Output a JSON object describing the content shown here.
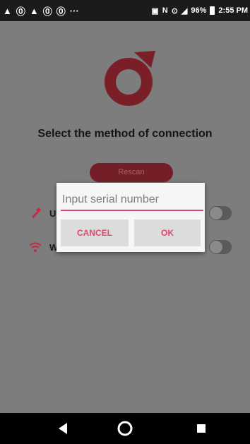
{
  "status_bar": {
    "notification_icons": [
      "warning-icon",
      "app-icon",
      "warning-icon",
      "app-icon",
      "app-icon"
    ],
    "overflow": "···",
    "battery": "96%",
    "time": "2:55 PM"
  },
  "main": {
    "title": "Select the method of connection",
    "rescan_label": "Rescan",
    "connections": [
      {
        "label": "US",
        "icon": "usb-icon",
        "color": "#c42a43"
      },
      {
        "label": "Wi",
        "icon": "wifi-icon",
        "color": "#c42a43"
      }
    ]
  },
  "dialog": {
    "placeholder": "Input serial number",
    "value": "",
    "cancel_label": "CANCEL",
    "ok_label": "OK"
  },
  "colors": {
    "accent": "#e2456e",
    "logo": "#7a1f28",
    "scrim_background": "#7d7d7d"
  }
}
